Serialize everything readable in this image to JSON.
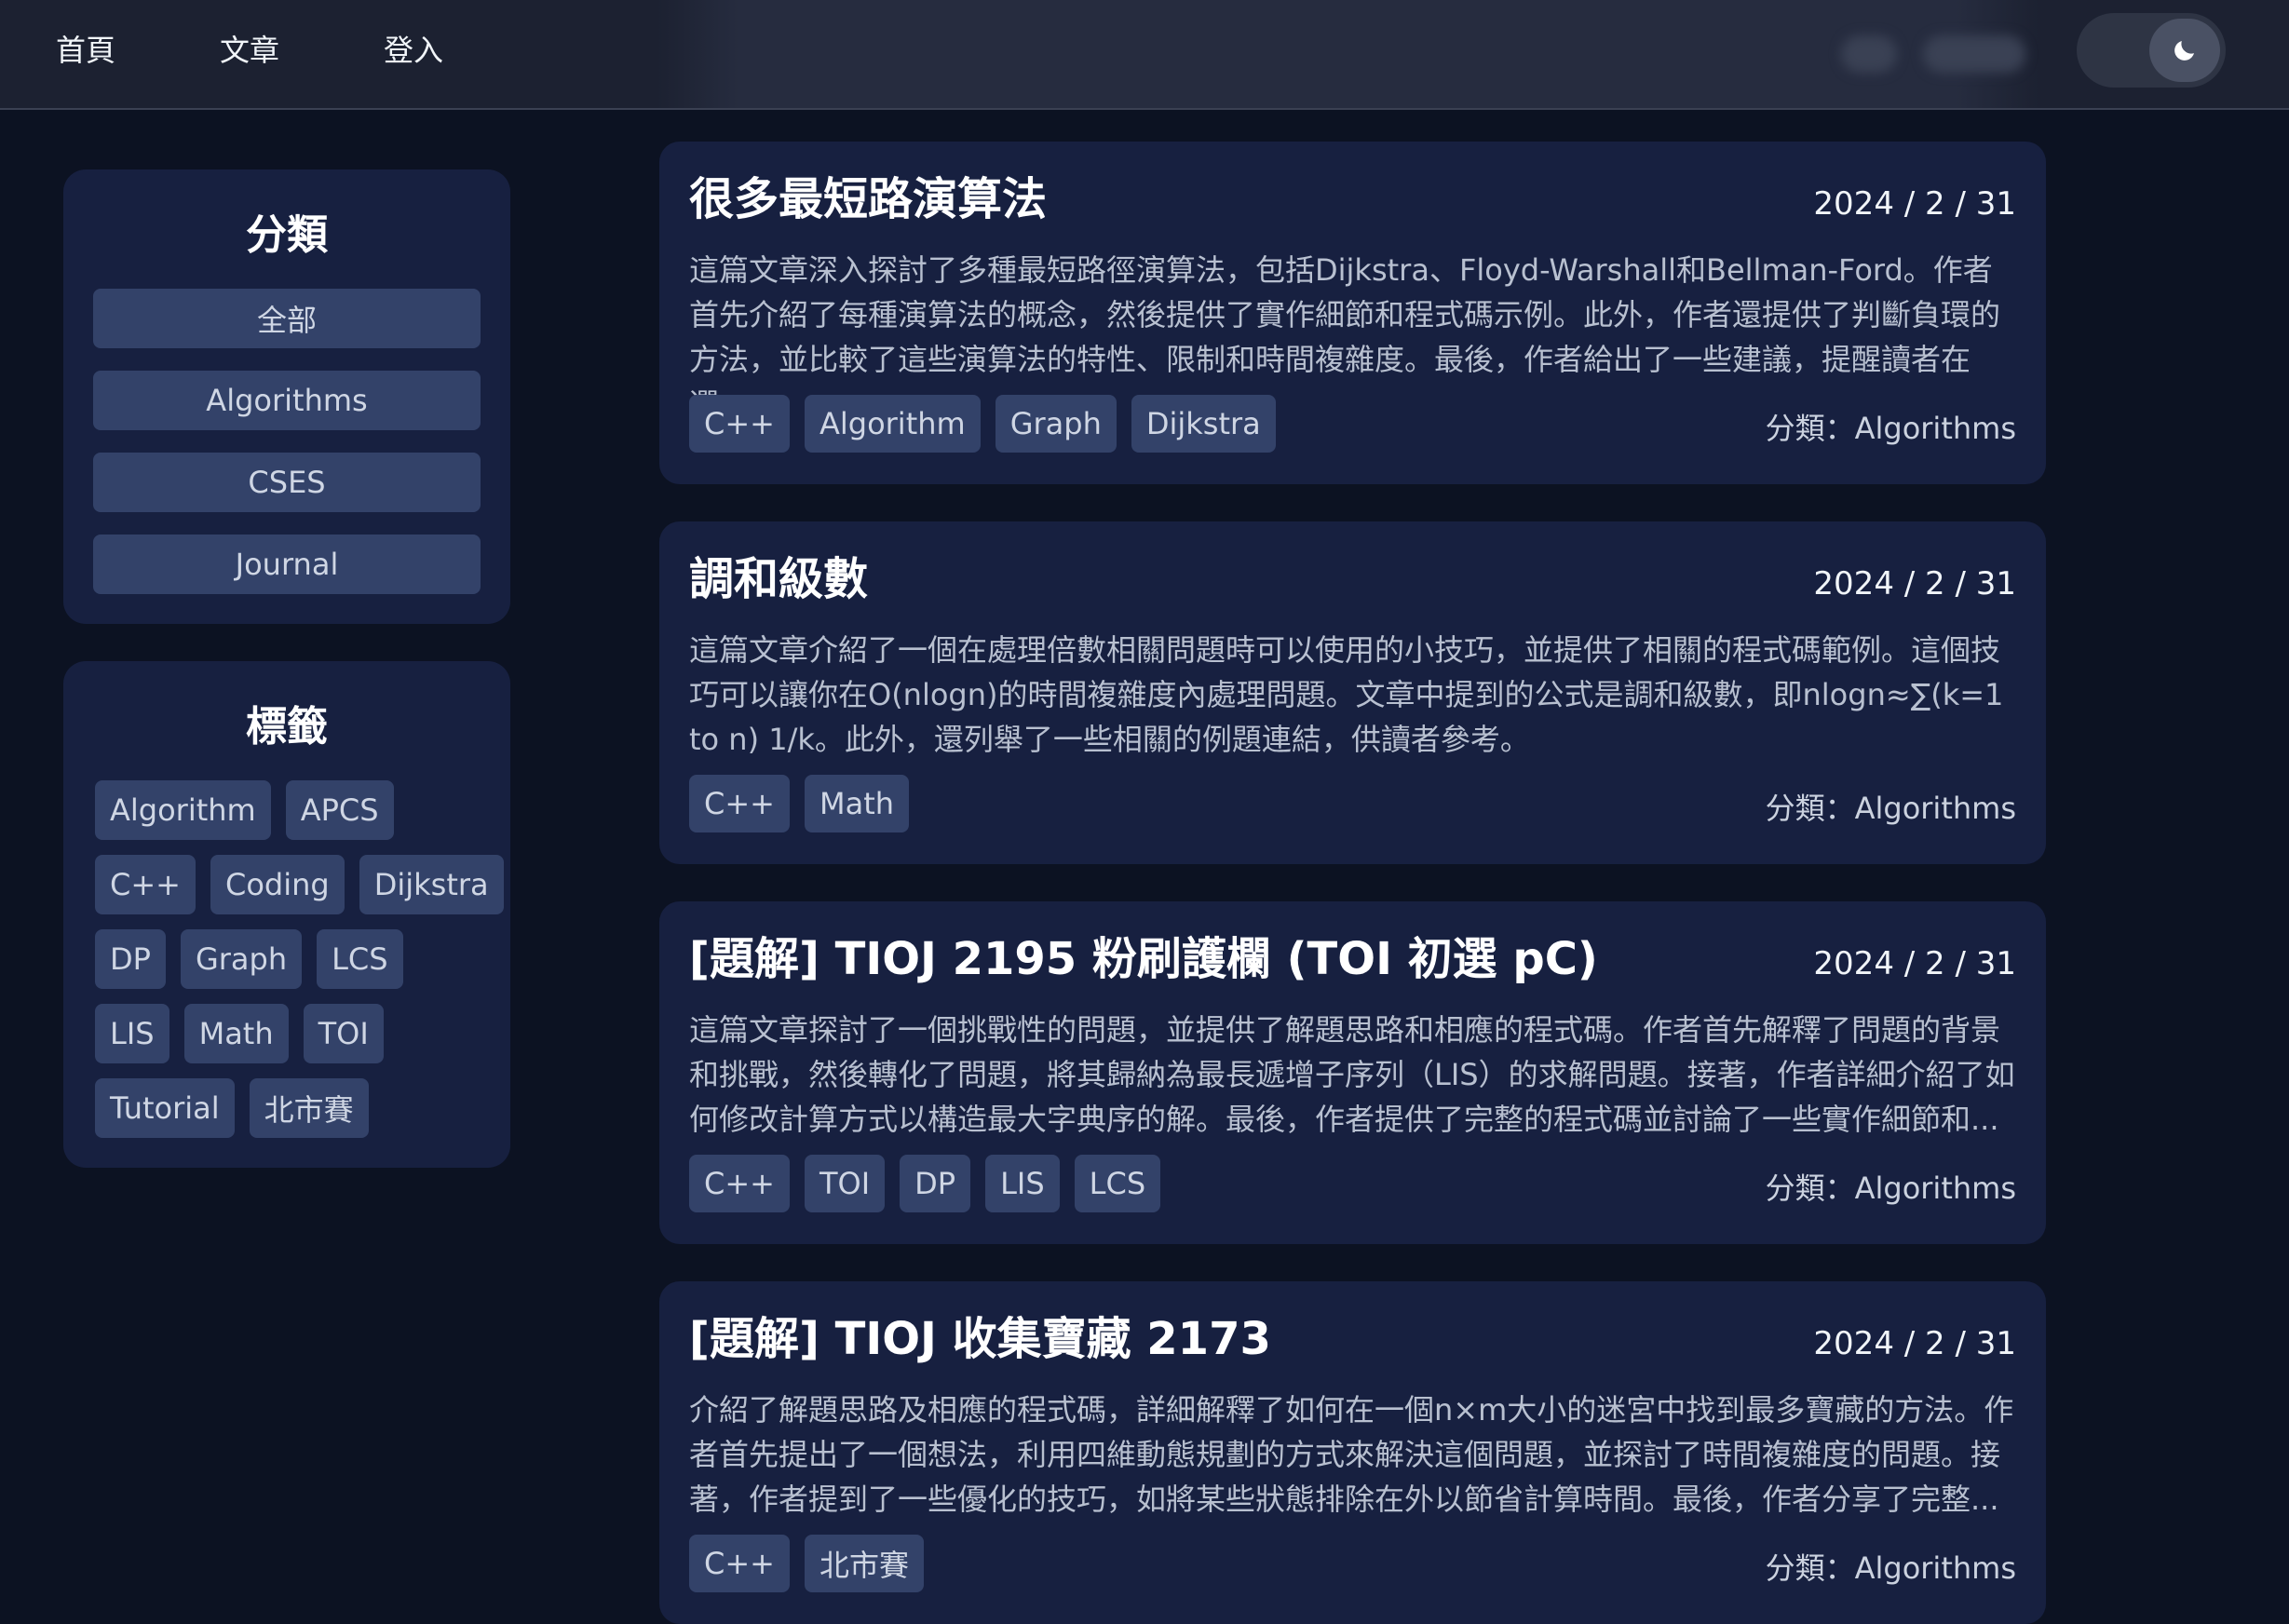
{
  "nav": {
    "home": "首頁",
    "articles": "文章",
    "login": "登入",
    "theme_icon": "moon-icon"
  },
  "sidebar": {
    "categories_title": "分類",
    "categories": [
      "全部",
      "Algorithms",
      "CSES",
      "Journal"
    ],
    "tags_title": "標籤",
    "tag_rows": [
      [
        "Algorithm",
        "APCS"
      ],
      [
        "C++",
        "Coding",
        "Dijkstra"
      ],
      [
        "DP",
        "Graph",
        "LCS"
      ],
      [
        "LIS",
        "Math",
        "TOI"
      ],
      [
        "Tutorial",
        "北市賽"
      ]
    ]
  },
  "posts": [
    {
      "title": "很多最短路演算法",
      "date": "2024 / 2 / 31",
      "description": "這篇文章深入探討了多種最短路徑演算法，包括Dijkstra、Floyd-Warshall和Bellman-Ford。作者首先介紹了每種演算法的概念，然後提供了實作細節和程式碼示例。此外，作者還提供了判斷負環的方法，並比較了這些演算法的特性、限制和時間複雜度。最後，作者給出了一些建議，提醒讀者在選...",
      "tags": [
        "C++",
        "Algorithm",
        "Graph",
        "Dijkstra"
      ],
      "category": "分類：Algorithms"
    },
    {
      "title": "調和級數",
      "date": "2024 / 2 / 31",
      "description": "這篇文章介紹了一個在處理倍數相關問題時可以使用的小技巧，並提供了相關的程式碼範例。這個技巧可以讓你在O(nlogn)的時間複雜度內處理問題。文章中提到的公式是調和級數，即nlogn≈∑(k=1 to n) 1/k。此外，還列舉了一些相關的例題連結，供讀者參考。",
      "tags": [
        "C++",
        "Math"
      ],
      "category": "分類：Algorithms"
    },
    {
      "title": "[題解] TIOJ 2195 粉刷護欄 (TOI 初選 pC)",
      "date": "2024 / 2 / 31",
      "description": "這篇文章探討了一個挑戰性的問題，並提供了解題思路和相應的程式碼。作者首先解釋了問題的背景和挑戰，然後轉化了問題，將其歸納為最長遞增子序列（LIS）的求解問題。接著，作者詳細介紹了如何修改計算方式以構造最大字典序的解。最後，作者提供了完整的程式碼並討論了一些實作細節和...",
      "tags": [
        "C++",
        "TOI",
        "DP",
        "LIS",
        "LCS"
      ],
      "category": "分類：Algorithms"
    },
    {
      "title": "[題解] TIOJ 收集寶藏 2173",
      "date": "2024 / 2 / 31",
      "description": "介紹了解題思路及相應的程式碼，詳細解釋了如何在一個n×m大小的迷宮中找到最多寶藏的方法。作者首先提出了一個想法，利用四維動態規劃的方式來解決這個問題，並探討了時間複雜度的問題。接著，作者提到了一些優化的技巧，如將某些狀態排除在外以節省計算時間。最後，作者分享了完整...",
      "tags": [
        "C++",
        "北市賽"
      ],
      "category": "分類：Algorithms"
    }
  ]
}
